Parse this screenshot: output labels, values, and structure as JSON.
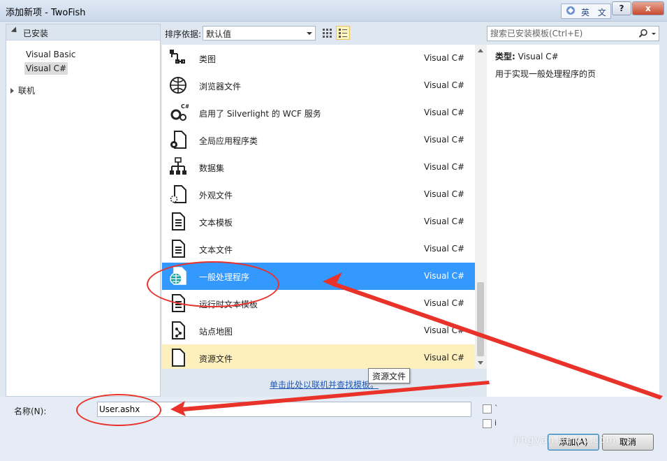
{
  "window": {
    "title": "添加新项 - TwoFish",
    "ime_label": "英 文",
    "help_label": "?",
    "close_label": "x"
  },
  "tree": {
    "installed_label": "已安装",
    "children": [
      "Visual Basic",
      "Visual C#"
    ],
    "selected": "Visual C#",
    "online_label": "联机"
  },
  "toolbar": {
    "sort_label": "排序依据:",
    "sort_value": "默认值"
  },
  "templates": [
    {
      "name": "类图",
      "lang": "Visual C#",
      "icon": "class-diagram-icon"
    },
    {
      "name": "浏览器文件",
      "lang": "Visual C#",
      "icon": "browser-file-icon"
    },
    {
      "name": "启用了 Silverlight 的 WCF 服务",
      "lang": "Visual C#",
      "icon": "wcf-service-icon"
    },
    {
      "name": "全局应用程序类",
      "lang": "Visual C#",
      "icon": "global-app-class-icon"
    },
    {
      "name": "数据集",
      "lang": "Visual C#",
      "icon": "dataset-icon"
    },
    {
      "name": "外观文件",
      "lang": "Visual C#",
      "icon": "skin-file-icon"
    },
    {
      "name": "文本模板",
      "lang": "Visual C#",
      "icon": "text-template-icon"
    },
    {
      "name": "文本文件",
      "lang": "Visual C#",
      "icon": "text-file-icon"
    },
    {
      "name": "一般处理程序",
      "lang": "Visual C#",
      "icon": "generic-handler-icon",
      "state": "selected"
    },
    {
      "name": "运行时文本模板",
      "lang": "Visual C#",
      "icon": "runtime-text-template-icon"
    },
    {
      "name": "站点地图",
      "lang": "Visual C#",
      "icon": "sitemap-icon"
    },
    {
      "name": "资源文件",
      "lang": "Visual C#",
      "icon": "resource-file-icon",
      "state": "hover"
    }
  ],
  "online_link": "单击此处以联机并查找模板。",
  "tooltip": "资源文件",
  "search": {
    "placeholder": "搜索已安装模板(Ctrl+E)"
  },
  "details": {
    "type_label": "类型:",
    "type_value": "Visual C#",
    "description": "用于实现一般处理程序的页"
  },
  "name_field": {
    "label": "名称(N):",
    "value": "User.ashx"
  },
  "checkbox_labels": [
    "ˋ",
    "i"
  ],
  "buttons": {
    "add": "添加(A)",
    "cancel": "取消"
  },
  "watermark": "jingyan.baidu.com",
  "colors": {
    "selection": "#3399ff",
    "hover": "#fdf0bd",
    "annotation": "#e8322a",
    "link": "#1f57b6"
  }
}
